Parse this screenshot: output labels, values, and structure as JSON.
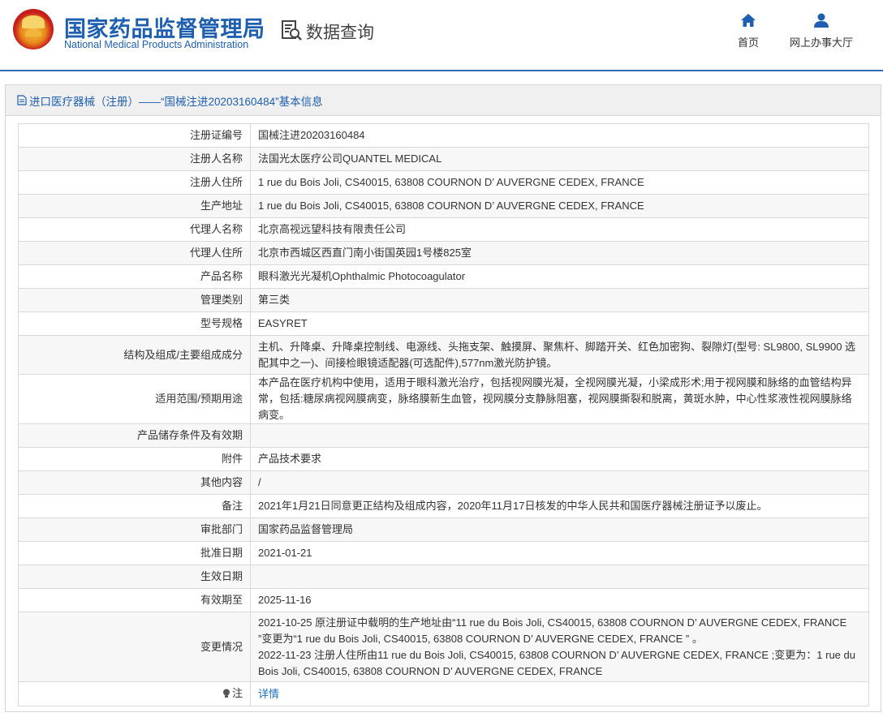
{
  "header": {
    "org_name_cn": "国家药品监督管理局",
    "org_name_en": "National Medical Products Administration",
    "section_title": "数据查询",
    "nav": [
      {
        "label": "首页",
        "icon": "home-icon"
      },
      {
        "label": "网上办事大厅",
        "icon": "user-icon"
      }
    ],
    "brand_color": "#1f5fb0"
  },
  "panel": {
    "title": "进口医疗器械（注册）——“国械注进20203160484”基本信息",
    "title_icon": "document-icon"
  },
  "rows": [
    {
      "label": "注册证编号",
      "value": "国械注进20203160484"
    },
    {
      "label": "注册人名称",
      "value": "法国光太医疗公司QUANTEL MEDICAL"
    },
    {
      "label": "注册人住所",
      "value": "1 rue du Bois Joli, CS40015, 63808 COURNON D’ AUVERGNE CEDEX, FRANCE"
    },
    {
      "label": "生产地址",
      "value": "1 rue du Bois Joli, CS40015, 63808 COURNON D’ AUVERGNE CEDEX, FRANCE"
    },
    {
      "label": "代理人名称",
      "value": "北京高视远望科技有限责任公司"
    },
    {
      "label": "代理人住所",
      "value": "北京市西城区西直门南小街国英园1号楼825室"
    },
    {
      "label": "产品名称",
      "value": "眼科激光光凝机Ophthalmic Photocoagulator"
    },
    {
      "label": "管理类别",
      "value": "第三类"
    },
    {
      "label": "型号规格",
      "value": "EASYRET"
    },
    {
      "label": "结构及组成/主要组成成分",
      "value": "主机、升降桌、升降桌控制线、电源线、头拖支架、触摸屏、聚焦杆、脚踏开关、红色加密狗、裂隙灯(型号: SL9800, SL9900 选配其中之一)、间接检眼镜适配器(可选配件),577nm激光防护镜。"
    },
    {
      "label": "适用范围/预期用途",
      "value": "本产品在医疗机构中使用，适用于眼科激光治疗，包括视网膜光凝，全视网膜光凝，小梁成形术;用于视网膜和脉络的血管结构异常，包括:糖尿病视网膜病变，脉络膜新生血管，视网膜分支静脉阻塞，视网膜撕裂和脱离，黄斑水肿，中心性浆液性视网膜脉络病变。"
    },
    {
      "label": "产品储存条件及有效期",
      "value": ""
    },
    {
      "label": "附件",
      "value": "产品技术要求"
    },
    {
      "label": "其他内容",
      "value": "/"
    },
    {
      "label": "备注",
      "value": "2021年1月21日同意更正结构及组成内容，2020年11月17日核发的中华人民共和国医疗器械注册证予以废止。"
    },
    {
      "label": "审批部门",
      "value": "国家药品监督管理局"
    },
    {
      "label": "批准日期",
      "value": "2021-01-21"
    },
    {
      "label": "生效日期",
      "value": ""
    },
    {
      "label": "有效期至",
      "value": "2025-11-16"
    },
    {
      "label": "变更情况",
      "value": "2021-10-25 原注册证中载明的生产地址由“11 rue du Bois Joli, CS40015, 63808 COURNON D’ AUVERGNE CEDEX, FRANCE ”变更为“1 rue du Bois Joli, CS40015, 63808 COURNON D’ AUVERGNE CEDEX, FRANCE ” 。\n2022-11-23 注册人住所由11 rue du Bois Joli, CS40015, 63808 COURNON D’ AUVERGNE CEDEX, FRANCE ;变更为：1 rue du Bois Joli, CS40015, 63808 COURNON D’ AUVERGNE CEDEX, FRANCE"
    }
  ],
  "note": {
    "label": "注",
    "icon": "bulb-icon",
    "link_text": "详情"
  }
}
